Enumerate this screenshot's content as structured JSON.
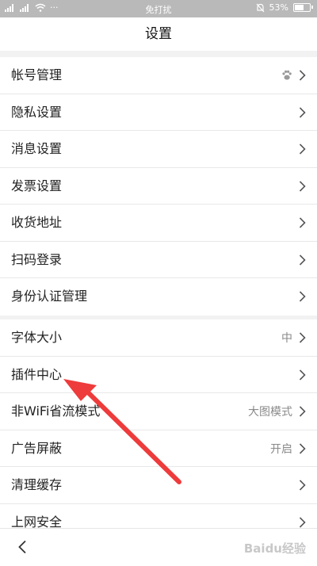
{
  "status_bar": {
    "center_text": "免打扰",
    "battery": "53%"
  },
  "header": {
    "title": "设置"
  },
  "group1": [
    {
      "label": "帐号管理",
      "value": "",
      "icon": "paw-icon"
    },
    {
      "label": "隐私设置",
      "value": ""
    },
    {
      "label": "消息设置",
      "value": ""
    },
    {
      "label": "发票设置",
      "value": ""
    },
    {
      "label": "收货地址",
      "value": ""
    },
    {
      "label": "扫码登录",
      "value": ""
    },
    {
      "label": "身份认证管理",
      "value": ""
    }
  ],
  "group2": [
    {
      "label": "字体大小",
      "value": "中"
    },
    {
      "label": "插件中心",
      "value": ""
    },
    {
      "label": "非WiFi省流模式",
      "value": "大图模式"
    },
    {
      "label": "广告屏蔽",
      "value": "开启"
    },
    {
      "label": "清理缓存",
      "value": ""
    },
    {
      "label": "上网安全",
      "value": ""
    }
  ],
  "footer": {
    "back_icon": "back-chevron-icon",
    "watermark": "Baidu经验"
  },
  "annotation": {
    "color": "#ee3b3b",
    "icon": "red-arrow-annotation"
  }
}
